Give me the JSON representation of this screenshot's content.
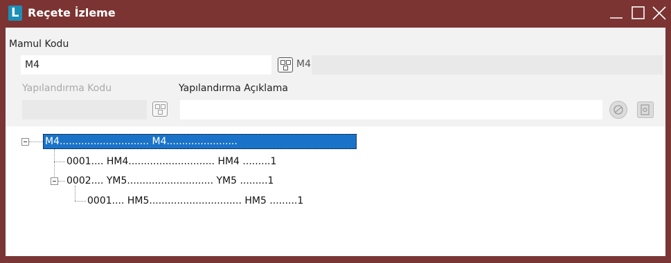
{
  "window": {
    "title": "Reçete İzleme",
    "icon_letter": "L"
  },
  "form": {
    "mamul_kodu_label": "Mamul Kodu",
    "mamul_kodu_value": "M4",
    "mamul_kodu_desc": "M4",
    "yapilandirma_kodu_label": "Yapılandırma Kodu",
    "yapilandirma_aciklama_label": "Yapılandırma Açıklama",
    "yapilandirma_kodu_value": "",
    "yapilandirma_aciklama_value": ""
  },
  "tree": {
    "root": "M4............................. M4.......................",
    "children": [
      {
        "text": "0001.... HM4............................ HM4 .........1"
      },
      {
        "text": "0002.... YM5............................ YM5 .........1",
        "children": [
          {
            "text": "0001.... HM5.............................. HM5 .........1"
          }
        ]
      }
    ]
  },
  "colors": {
    "titlebar": "#7b3432",
    "selection": "#1b73c9",
    "panel": "#f2f2f2"
  }
}
